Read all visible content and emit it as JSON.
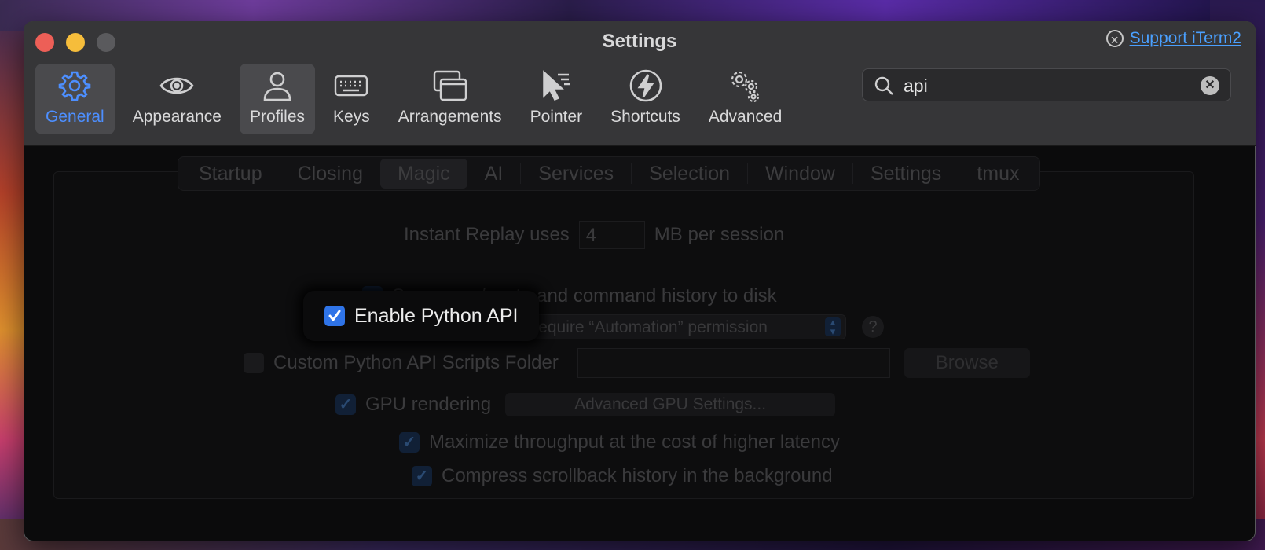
{
  "window": {
    "title": "Settings",
    "support_link": "Support iTerm2"
  },
  "toolbar": {
    "items": [
      {
        "label": "General",
        "icon": "gear-icon",
        "state": "active"
      },
      {
        "label": "Appearance",
        "icon": "eye-icon",
        "state": "normal"
      },
      {
        "label": "Profiles",
        "icon": "person-icon",
        "state": "hover"
      },
      {
        "label": "Keys",
        "icon": "keyboard-icon",
        "state": "normal"
      },
      {
        "label": "Arrangements",
        "icon": "windows-icon",
        "state": "normal"
      },
      {
        "label": "Pointer",
        "icon": "pointer-icon",
        "state": "normal"
      },
      {
        "label": "Shortcuts",
        "icon": "bolt-icon",
        "state": "normal"
      },
      {
        "label": "Advanced",
        "icon": "gears-icon",
        "state": "normal"
      }
    ]
  },
  "search": {
    "value": "api"
  },
  "tabs": [
    "Startup",
    "Closing",
    "Magic",
    "AI",
    "Services",
    "Selection",
    "Window",
    "Settings",
    "tmux"
  ],
  "selected_tab": "Magic",
  "settings": {
    "instant_replay_label": "Instant Replay uses",
    "instant_replay_value": "4",
    "instant_replay_unit": "MB per session",
    "save_history_label": "Save copy/paste and command history to disk",
    "enable_python_api_label": "Enable Python API",
    "enable_python_api_checked": true,
    "permission_popup": "Require “Automation” permission",
    "help_glyph": "?",
    "custom_scripts_label": "Custom Python API Scripts Folder",
    "browse_button": "Browse",
    "gpu_rendering_label": "GPU rendering",
    "advanced_gpu_button": "Advanced GPU Settings...",
    "maximize_throughput_label": "Maximize throughput at the cost of higher latency",
    "compress_scrollback_label": "Compress scrollback history in the background"
  },
  "colors": {
    "accent": "#2f74e8",
    "link": "#4aa0ff",
    "close": "#ed5f57",
    "minimize": "#f6bd3b"
  }
}
